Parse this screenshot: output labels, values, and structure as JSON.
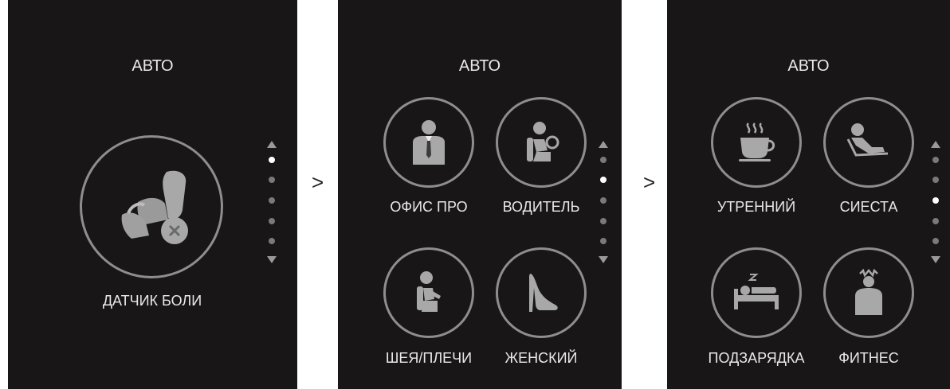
{
  "screens": [
    {
      "title": "АВТО",
      "items": [
        {
          "label": "ДАТЧИК БОЛИ",
          "icon": "massage-chair-icon"
        }
      ],
      "scroll_dots": 5,
      "active_dot": 0
    },
    {
      "title": "АВТО",
      "items": [
        {
          "label": "ОФИС ПРО",
          "icon": "office-worker-icon"
        },
        {
          "label": "ВОДИТЕЛЬ",
          "icon": "driver-icon"
        },
        {
          "label": "ШЕЯ/ПЛЕЧИ",
          "icon": "neck-shoulder-icon"
        },
        {
          "label": "ЖЕНСКИЙ",
          "icon": "high-heel-icon"
        }
      ],
      "scroll_dots": 5,
      "active_dot": 1
    },
    {
      "title": "АВТО",
      "items": [
        {
          "label": "УТРЕННИЙ",
          "icon": "coffee-cup-icon"
        },
        {
          "label": "СИЕСТА",
          "icon": "reclining-person-icon"
        },
        {
          "label": "ПОДЗАРЯДКА",
          "icon": "sleeping-person-icon"
        },
        {
          "label": "ФИТНЕС",
          "icon": "fitness-person-icon"
        }
      ],
      "scroll_dots": 5,
      "active_dot": 2
    }
  ],
  "separators": [
    ">",
    ">"
  ],
  "colors": {
    "screen_bg": "#181616",
    "circle_border": "#8e8e8e",
    "text": "#e9e9e9",
    "icon": "#a8a8a8",
    "dot_active": "#ffffff",
    "dot_inactive": "#7a7a7a"
  }
}
